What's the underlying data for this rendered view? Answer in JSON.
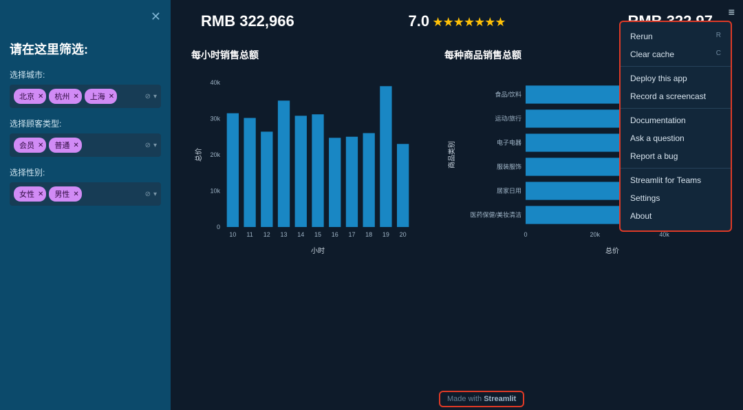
{
  "sidebar": {
    "title": "请在这里筛选:",
    "filters": {
      "city": {
        "label": "选择城市:",
        "chips": [
          "北京",
          "杭州",
          "上海"
        ]
      },
      "customer": {
        "label": "选择顾客类型:",
        "chips": [
          "会员",
          "普通"
        ]
      },
      "gender": {
        "label": "选择性别:",
        "chips": [
          "女性",
          "男性"
        ]
      }
    }
  },
  "kpis": {
    "total_sales": "RMB 322,966",
    "rating": "7.0",
    "avg_sales": "RMB 322.97"
  },
  "chart_data": [
    {
      "type": "bar",
      "title": "每小时销售总额",
      "xlabel": "小时",
      "ylabel": "总价",
      "ylim": [
        0,
        40000
      ],
      "categories": [
        "10",
        "11",
        "12",
        "13",
        "14",
        "15",
        "16",
        "17",
        "18",
        "19",
        "20"
      ],
      "values": [
        31500,
        30200,
        26400,
        35000,
        30800,
        31200,
        24700,
        25000,
        26000,
        39000,
        23000
      ],
      "yticks": [
        "0",
        "10k",
        "20k",
        "30k",
        "40k"
      ]
    },
    {
      "type": "bar",
      "orientation": "horizontal",
      "title": "每种商品销售总额",
      "xlabel": "总价",
      "ylabel": "商品类别",
      "xlim": [
        0,
        50000
      ],
      "categories": [
        "食品/饮料",
        "运动/旅行",
        "电子电器",
        "服装服饰",
        "居家日用",
        "医药保健/美妆清洁"
      ],
      "values": [
        50000,
        50000,
        50000,
        50000,
        50000,
        50000
      ],
      "xticks": [
        "0",
        "20k",
        "40k"
      ]
    }
  ],
  "menu": {
    "groups": [
      [
        {
          "label": "Rerun",
          "shortcut": "R"
        },
        {
          "label": "Clear cache",
          "shortcut": "C"
        }
      ],
      [
        {
          "label": "Deploy this app"
        },
        {
          "label": "Record a screencast"
        }
      ],
      [
        {
          "label": "Documentation"
        },
        {
          "label": "Ask a question"
        },
        {
          "label": "Report a bug"
        }
      ],
      [
        {
          "label": "Streamlit for Teams"
        },
        {
          "label": "Settings"
        },
        {
          "label": "About"
        }
      ]
    ]
  },
  "footer": {
    "made_with_pre": "Made with ",
    "made_with_brand": "Streamlit"
  }
}
